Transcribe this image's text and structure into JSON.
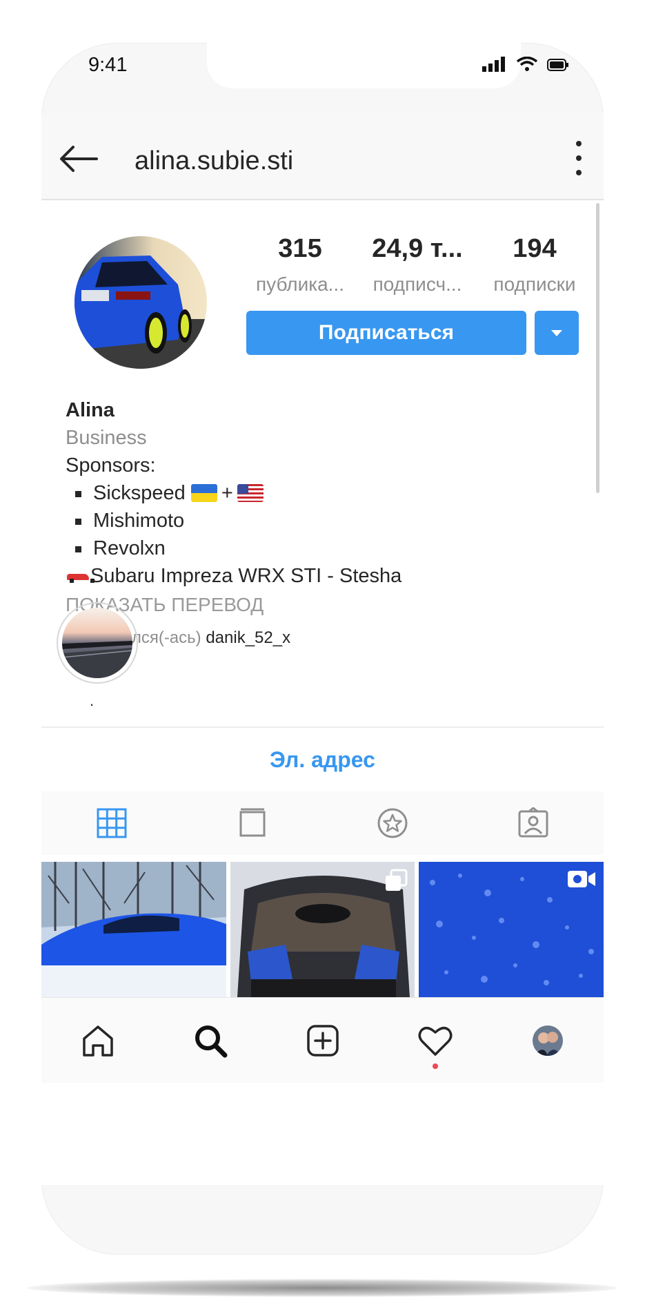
{
  "status_bar": {
    "time": "9:41"
  },
  "header": {
    "username": "alina.subie.sti"
  },
  "profile": {
    "stats": [
      {
        "value": "315",
        "label": "публика..."
      },
      {
        "value": "24,9 т...",
        "label": "подписч..."
      },
      {
        "value": "194",
        "label": "подписки"
      }
    ],
    "follow_label": "Подписаться"
  },
  "bio": {
    "name": "Alina",
    "category": "Business",
    "sponsors_heading": "Sponsors:",
    "sponsor_1": "Sickspeed",
    "sponsor_1_plus": "+",
    "sponsor_2": "Mishimoto",
    "sponsor_3": "Revolxn",
    "car_line": "Subaru Impreza WRX STI - Stesha",
    "translate_label": "ПОКАЗАТЬ ПЕРЕВОД",
    "followed_by_prefix": "Подписался(-ась)",
    "followed_by_user": "danik_52_x"
  },
  "highlight": {
    "label": "."
  },
  "contact": {
    "email_label": "Эл. адрес"
  },
  "colors": {
    "accent": "#3897f0",
    "text": "#262626",
    "secondary": "#8e8e8e",
    "notification": "#ed4956"
  }
}
